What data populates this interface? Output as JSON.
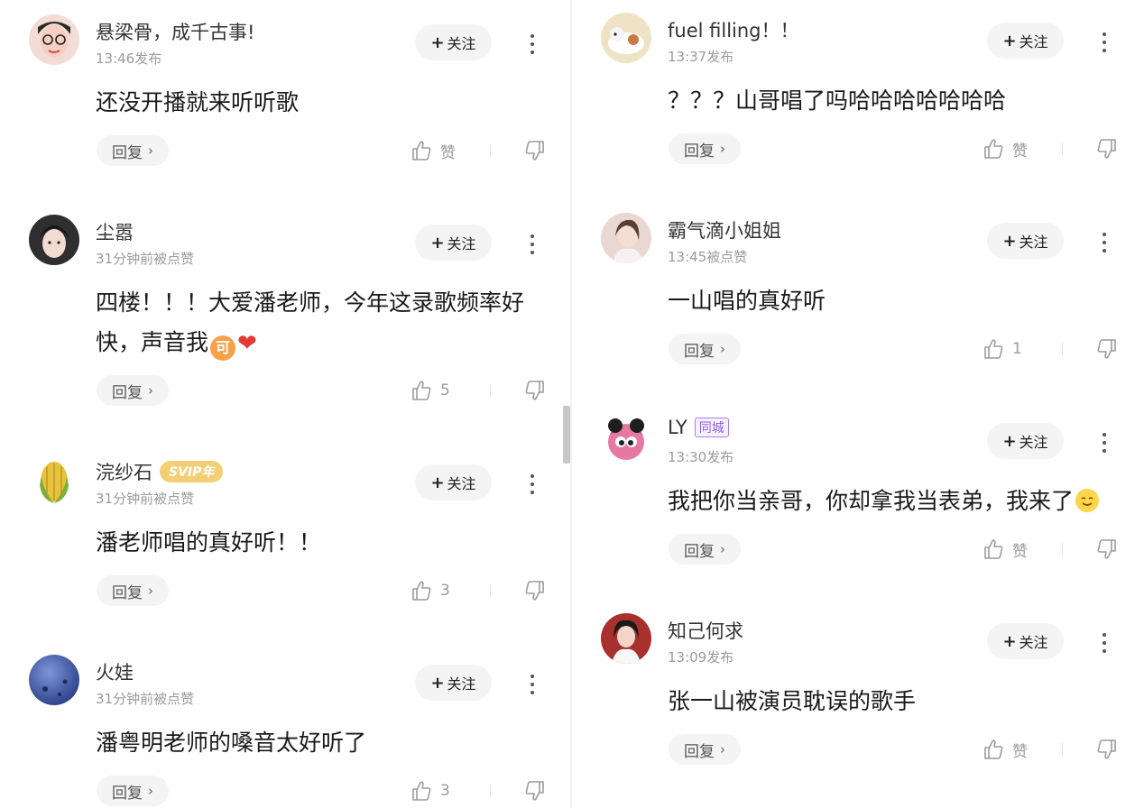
{
  "left_comments": [
    {
      "username": "悬梁骨，成千古事!",
      "meta": "13:46发布",
      "follow_label": "关注",
      "content": "还没开播就来听听歌",
      "reply_label": "回复",
      "like_text": "赞",
      "avatar_color": "#f2d6d2"
    },
    {
      "username": "尘嚣",
      "meta": "31分钟前被点赞",
      "follow_label": "关注",
      "content": "四楼！！！大爱潘老师，今年这录歌频率好快，声音我",
      "emoji_ke": "可",
      "emoji_heart": "❤",
      "reply_label": "回复",
      "like_text": "5",
      "avatar_color": "#3a3a3a"
    },
    {
      "username": "浣纱石",
      "badge": "SVIP年",
      "meta": "31分钟前被点赞",
      "follow_label": "关注",
      "content": "潘老师唱的真好听！！",
      "reply_label": "回复",
      "like_text": "3",
      "avatar_color": "#d9b230"
    },
    {
      "username": "火娃",
      "meta": "31分钟前被点赞",
      "follow_label": "关注",
      "content": "潘粤明老师的嗓音太好听了",
      "reply_label": "回复",
      "like_text": "3",
      "avatar_color": "#4b6bb8"
    }
  ],
  "right_comments": [
    {
      "username": "fuel filling！！",
      "meta": "13:37发布",
      "follow_label": "关注",
      "content": "？？？山哥唱了吗哈哈哈哈哈哈哈",
      "reply_label": "回复",
      "like_text": "赞",
      "avatar_color": "#e8d6b0"
    },
    {
      "username": "霸气滴小姐姐",
      "meta": "13:45被点赞",
      "follow_label": "关注",
      "content": "一山唱的真好听",
      "reply_label": "回复",
      "like_text": "1",
      "avatar_color": "#e6c9c0"
    },
    {
      "username": "LY",
      "badge": "同城",
      "meta": "13:30发布",
      "follow_label": "关注",
      "content": "我把你当亲哥，你却拿我当表弟，我来了",
      "reply_label": "回复",
      "like_text": "赞",
      "avatar_color": "#e07aa0"
    },
    {
      "username": "知己何求",
      "meta": "13:09发布",
      "follow_label": "关注",
      "content": "张一山被演员耽误的歌手",
      "reply_label": "回复",
      "like_text": "赞",
      "avatar_color": "#b0413e"
    }
  ]
}
